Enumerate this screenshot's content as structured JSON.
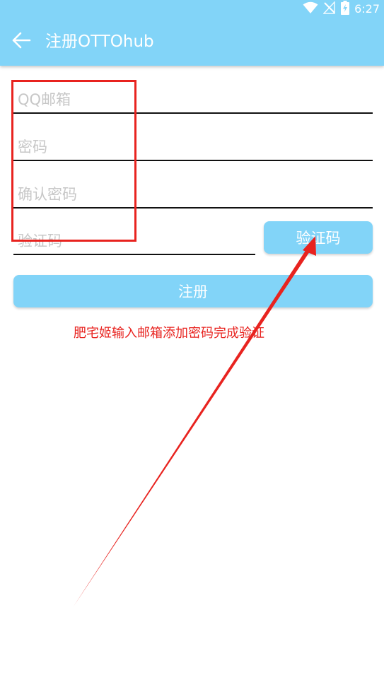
{
  "status_bar": {
    "time": "6:27",
    "icons": [
      "wifi-icon",
      "no-signal-icon",
      "battery-charging-icon"
    ]
  },
  "header": {
    "back_icon": "arrow-left-icon",
    "title": "注册OTTOhub"
  },
  "form": {
    "email_placeholder": "QQ邮箱",
    "password_placeholder": "密码",
    "confirm_password_placeholder": "确认密码",
    "code_placeholder": "验证码",
    "code_button_label": "验证码",
    "register_button_label": "注册"
  },
  "annotation": {
    "note": "肥宅姬输入邮箱添加密码完成验证"
  },
  "colors": {
    "accent": "#82d4f8",
    "annotation_red": "#e8231f",
    "divider": "#111111",
    "placeholder": "#c7c7c7"
  }
}
